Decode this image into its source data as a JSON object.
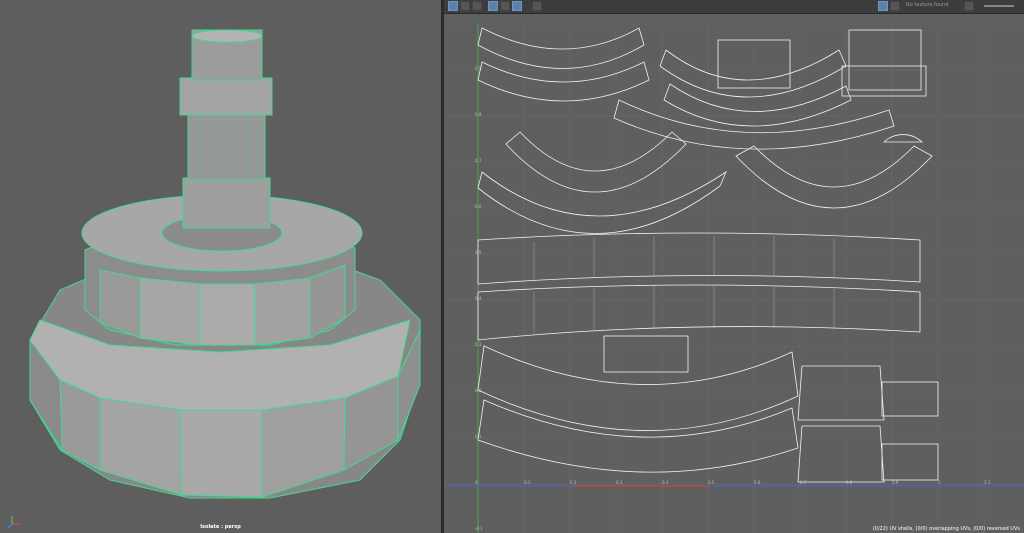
{
  "viewport": {
    "label": "Isolate : persp",
    "axis_colors": {
      "x": "#e04848",
      "y": "#50d050",
      "z": "#5a7dff"
    },
    "wire_color": "#42d990"
  },
  "uv_editor": {
    "toolbar": {
      "texture_field": "No texture found",
      "buttons": [
        "uv-display-icon",
        "checker-icon",
        "shaded-icon",
        "distortion-icon",
        "border-icon",
        "grid-icon",
        "image-icon",
        "dim-icon",
        "exposure-icon",
        "gamma-icon"
      ]
    },
    "axis_ticks_u": [
      "0.1",
      "0.2",
      "0.3",
      "0.4",
      "0.5",
      "0.6",
      "0.7",
      "0.8",
      "0.9",
      "1",
      "1.1"
    ],
    "axis_ticks_v": [
      "0.9",
      "0.8",
      "0.7",
      "0.6",
      "0.5",
      "0.4",
      "0.3",
      "0.2",
      "0.1",
      "0",
      "-0.1"
    ],
    "status": "(0/22) UV shells, (0/0) overlapping UVs, (0/0) reversed UVs"
  }
}
